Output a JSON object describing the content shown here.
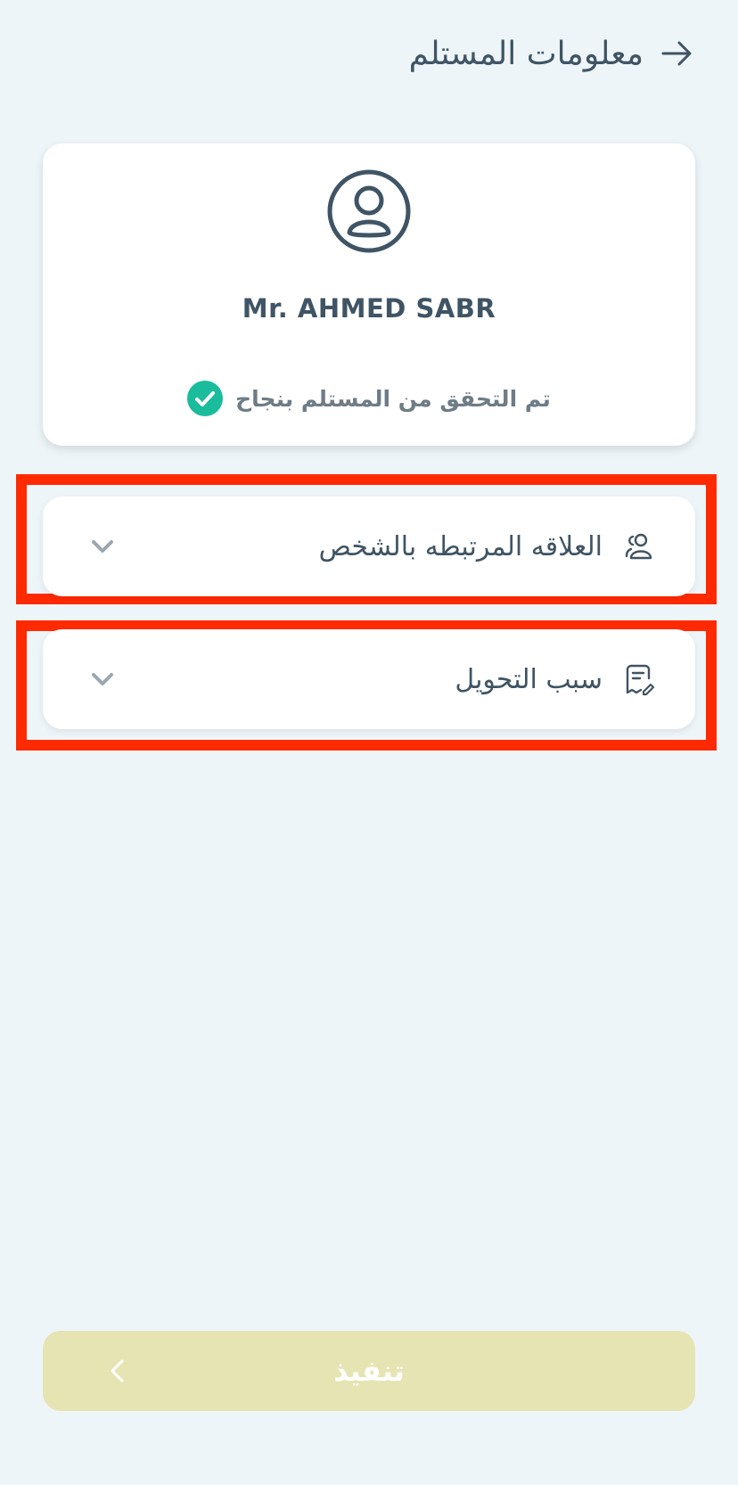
{
  "header": {
    "title": "معلومات المستلم",
    "back_icon": "arrow-right-icon"
  },
  "recipient": {
    "avatar_icon": "user-circle-icon",
    "name": "Mr. AHMED SABR",
    "verified_text": "تم التحقق من المستلم بنجاح",
    "verified_icon": "check-circle-icon",
    "verified_color": "#1abc9c"
  },
  "fields": {
    "relationship": {
      "label": "العلاقه المرتبطه بالشخص",
      "icon": "users-icon",
      "dropdown_icon": "chevron-down-icon"
    },
    "transfer_reason": {
      "label": "سبب التحويل",
      "icon": "document-edit-icon",
      "dropdown_icon": "chevron-down-icon"
    }
  },
  "submit": {
    "label": "تنفيذ",
    "icon": "chevron-left-icon",
    "disabled_color": "#e7e4b4"
  },
  "highlight_color": "#ff2a00"
}
